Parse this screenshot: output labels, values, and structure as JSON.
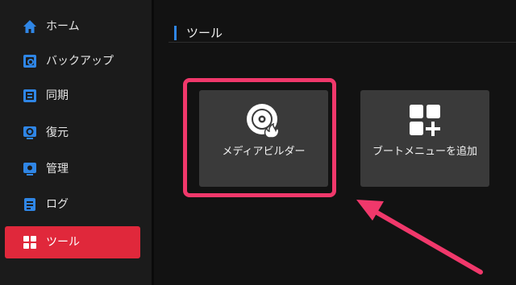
{
  "sidebar": {
    "items": [
      {
        "label": "ホーム",
        "icon": "home-icon"
      },
      {
        "label": "バックアップ",
        "icon": "backup-icon"
      },
      {
        "label": "同期",
        "icon": "sync-icon"
      },
      {
        "label": "復元",
        "icon": "restore-icon"
      },
      {
        "label": "管理",
        "icon": "manage-icon"
      },
      {
        "label": "ログ",
        "icon": "log-icon"
      },
      {
        "label": "ツール",
        "icon": "tools-icon",
        "active": true
      }
    ]
  },
  "main": {
    "section_title": "ツール",
    "tiles": [
      {
        "label": "メディアビルダー",
        "icon": "media-builder-disc-icon"
      },
      {
        "label": "ブートメニューを追加",
        "icon": "add-boot-menu-icon"
      }
    ]
  },
  "colors": {
    "accent_blue": "#2f86e6",
    "active_red": "#e0283b",
    "highlight_pink": "#f0386b",
    "tile_bg": "#3a3a3a"
  }
}
